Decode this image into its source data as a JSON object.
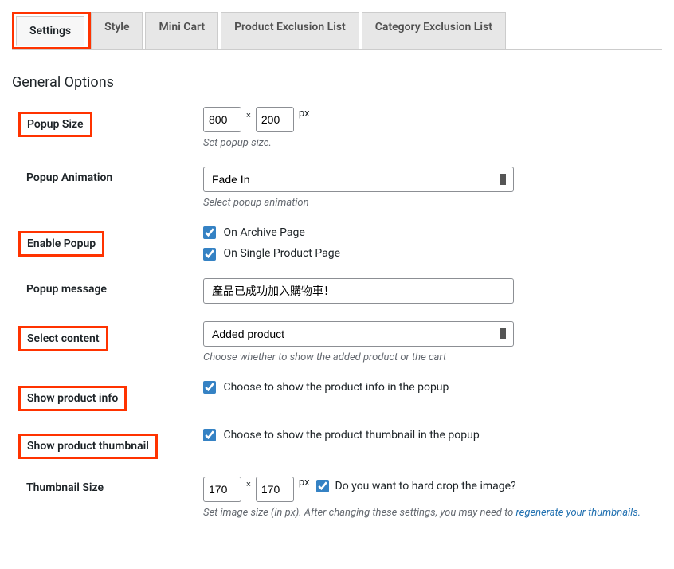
{
  "tabs": {
    "settings": "Settings",
    "style": "Style",
    "minicart": "Mini Cart",
    "product_exclusion": "Product Exclusion List",
    "category_exclusion": "Category Exclusion List"
  },
  "section_title": "General Options",
  "popup_size": {
    "label": "Popup Size",
    "width": "800",
    "height": "200",
    "sep": "×",
    "unit": "px",
    "desc": "Set popup size."
  },
  "popup_animation": {
    "label": "Popup Animation",
    "value": "Fade In",
    "desc": "Select popup animation"
  },
  "enable_popup": {
    "label": "Enable Popup",
    "opt_archive": "On Archive Page",
    "opt_single": "On Single Product Page"
  },
  "popup_message": {
    "label": "Popup message",
    "value": "產品已成功加入購物車！"
  },
  "select_content": {
    "label": "Select content",
    "value": "Added product",
    "desc": "Choose whether to show the added product or the cart"
  },
  "show_product_info": {
    "label": "Show product info",
    "opt": "Choose to show the product info in the popup"
  },
  "show_product_thumbnail": {
    "label": "Show product thumbnail",
    "opt": "Choose to show the product thumbnail in the popup"
  },
  "thumbnail_size": {
    "label": "Thumbnail Size",
    "width": "170",
    "height": "170",
    "sep": "×",
    "unit": "px",
    "crop_label": "Do you want to hard crop the image?",
    "desc_pre": "Set image size (in px). After changing these settings, you may need to ",
    "desc_link": "regenerate your thumbnails."
  }
}
